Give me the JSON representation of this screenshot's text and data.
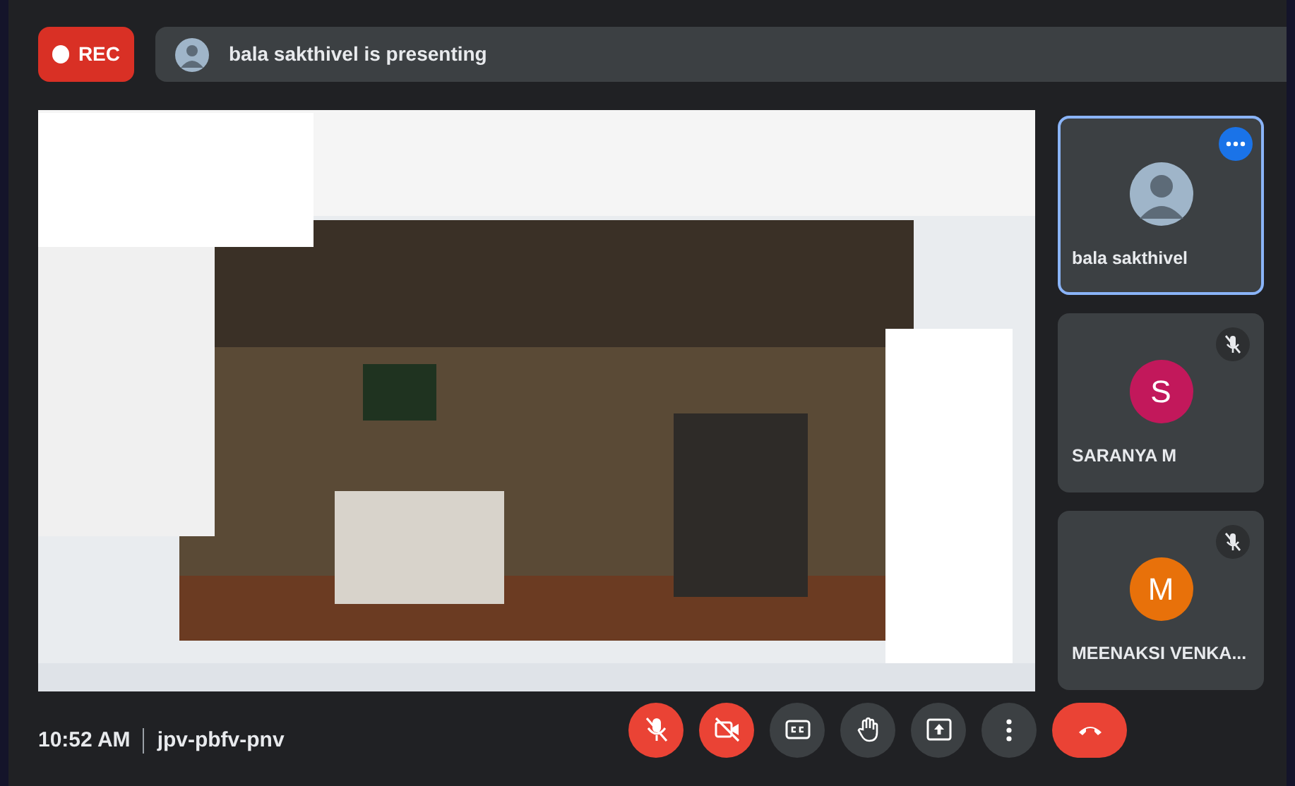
{
  "recording": {
    "label": "REC"
  },
  "presenter_bar": {
    "text": "bala sakthivel is presenting"
  },
  "participants": [
    {
      "name": "bala sakthivel",
      "selected": true,
      "muted": false,
      "menu": true
    },
    {
      "name": "SARANYA M",
      "kind": "letter",
      "initial": "S",
      "color": "#c2185b",
      "selected": false,
      "muted": true,
      "menu": false
    },
    {
      "name": "MEENAKSI VENKA...",
      "kind": "letter",
      "initial": "M",
      "color": "#e8710a",
      "selected": false,
      "muted": true,
      "menu": false
    }
  ],
  "meeting": {
    "time": "10:52 AM",
    "code": "jpv-pbfv-pnv"
  },
  "controls": [
    {
      "kind": "mic",
      "alert": true
    },
    {
      "kind": "camera",
      "alert": true
    },
    {
      "kind": "captions",
      "alert": false
    },
    {
      "kind": "hand",
      "alert": false
    },
    {
      "kind": "present",
      "alert": false
    },
    {
      "kind": "more",
      "alert": false
    },
    {
      "kind": "end",
      "alert": true
    }
  ]
}
